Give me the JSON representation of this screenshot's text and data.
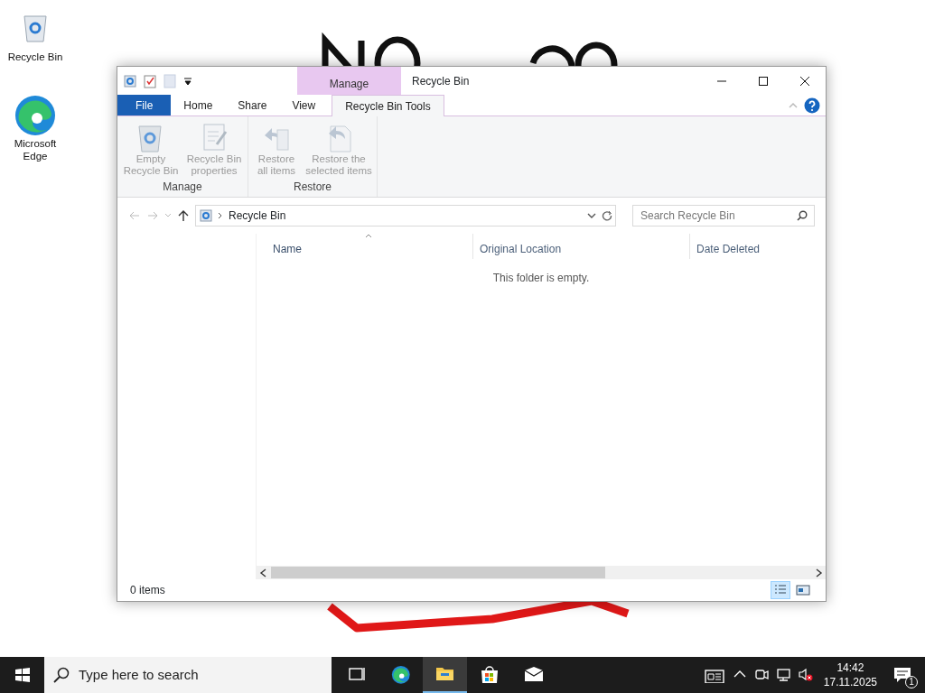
{
  "desktop_icons": [
    {
      "label": "Recycle Bin",
      "kind": "bin"
    },
    {
      "label": "Microsoft Edge",
      "kind": "edge"
    }
  ],
  "window": {
    "title": "Recycle Bin",
    "context_tab": "Manage",
    "ribbon_tabs": [
      {
        "label": "File",
        "kind": "file",
        "selected": false
      },
      {
        "label": "Home",
        "kind": "normal",
        "selected": false
      },
      {
        "label": "Share",
        "kind": "normal",
        "selected": false
      },
      {
        "label": "View",
        "kind": "normal",
        "selected": false
      },
      {
        "label": "Recycle Bin Tools",
        "kind": "context",
        "selected": true
      }
    ],
    "ribbon_groups": [
      {
        "label": "Manage",
        "buttons": [
          {
            "label": "Empty Recycle Bin",
            "kind": "bin",
            "disabled": true
          },
          {
            "label": "Recycle Bin properties",
            "kind": "props",
            "disabled": true
          }
        ]
      },
      {
        "label": "Restore",
        "buttons": [
          {
            "label": "Restore all items",
            "kind": "restore-all",
            "disabled": true
          },
          {
            "label": "Restore the selected items",
            "kind": "restore-sel",
            "disabled": true
          }
        ]
      }
    ],
    "address": "Recycle Bin",
    "search": {
      "placeholder": "Search Recycle Bin"
    },
    "columns": [
      {
        "label": "Name",
        "sorted": true
      },
      {
        "label": "Original Location",
        "sorted": false
      },
      {
        "label": "Date Deleted",
        "sorted": false
      }
    ],
    "empty_message": "This folder is empty.",
    "status": "0 items",
    "views": [
      {
        "kind": "details",
        "selected": true
      },
      {
        "kind": "tiles",
        "selected": false
      }
    ]
  },
  "taskbar": {
    "search": {
      "placeholder": "Type here to search"
    },
    "apps": [
      {
        "kind": "taskview",
        "selected": false
      },
      {
        "kind": "edge",
        "selected": false
      },
      {
        "kind": "explorer",
        "selected": true
      },
      {
        "kind": "store",
        "selected": false
      },
      {
        "kind": "mail",
        "selected": false
      }
    ],
    "time": "14:42",
    "date": "17.11.2025",
    "notifications": "1"
  }
}
